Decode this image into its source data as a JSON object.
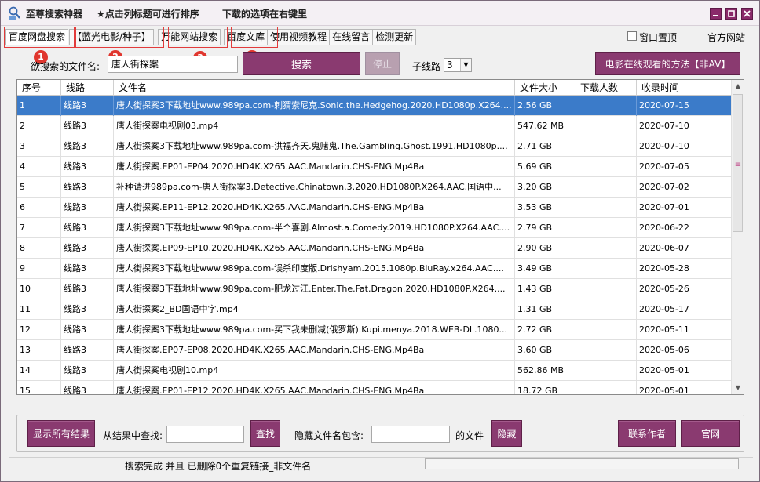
{
  "title_bar": {
    "app_name": "至尊搜索神器",
    "hint_sort": "★点击列标题可进行排序",
    "hint_download": "下载的选项在右键里"
  },
  "tabs": [
    {
      "label": "百度网盘搜索"
    },
    {
      "label": "【蓝光电影/种子】"
    },
    {
      "label": "万能网站搜索"
    },
    {
      "label": "百度文库"
    },
    {
      "label": "使用视频教程"
    },
    {
      "label": "在线留言"
    },
    {
      "label": "检测更新"
    }
  ],
  "badges": [
    "1",
    "2",
    "3",
    "4"
  ],
  "top_right": {
    "pin_label": "窗口置顶",
    "official_site": "官方网站"
  },
  "search": {
    "label": "欲搜索的文件名:",
    "value": "唐人街探案",
    "search_button": "搜索",
    "stop_button": "停止",
    "thread_label": "子线路",
    "thread_value": "3",
    "movie_button": "电影在线观看的方法【非AV】"
  },
  "table": {
    "columns": [
      "序号",
      "线路",
      "文件名",
      "文件大小",
      "下载人数",
      "收录时间"
    ],
    "rows": [
      [
        "1",
        "线路3",
        "唐人街探案3下载地址www.989pa.com-刺猬索尼克.Sonic.the.Hedgehog.2020.HD1080p.X264....",
        "2.56 GB",
        "",
        "2020-07-15"
      ],
      [
        "2",
        "线路3",
        "唐人街探案电视剧03.mp4",
        "547.62 MB",
        "",
        "2020-07-10"
      ],
      [
        "3",
        "线路3",
        "唐人街探案3下载地址www.989pa.com-洪福齐天.鬼赌鬼.The.Gambling.Ghost.1991.HD1080p....",
        "2.71 GB",
        "",
        "2020-07-10"
      ],
      [
        "4",
        "线路3",
        "唐人街探案.EP01-EP04.2020.HD4K.X265.AAC.Mandarin.CHS-ENG.Mp4Ba",
        "5.69 GB",
        "",
        "2020-07-05"
      ],
      [
        "5",
        "线路3",
        "补种请进989pa.com-唐人街探案3.Detective.Chinatown.3.2020.HD1080P.X264.AAC.国语中...",
        "3.20 GB",
        "",
        "2020-07-02"
      ],
      [
        "6",
        "线路3",
        "唐人街探案.EP11-EP12.2020.HD4K.X265.AAC.Mandarin.CHS-ENG.Mp4Ba",
        "3.53 GB",
        "",
        "2020-07-01"
      ],
      [
        "7",
        "线路3",
        "唐人街探案3下载地址www.989pa.com-半个喜剧.Almost.a.Comedy.2019.HD1080P.X264.AAC....",
        "2.79 GB",
        "",
        "2020-06-22"
      ],
      [
        "8",
        "线路3",
        "唐人街探案.EP09-EP10.2020.HD4K.X265.AAC.Mandarin.CHS-ENG.Mp4Ba",
        "2.90 GB",
        "",
        "2020-06-07"
      ],
      [
        "9",
        "线路3",
        "唐人街探案3下载地址www.989pa.com-误杀印度版.Drishyam.2015.1080p.BluRay.x264.AAC....",
        "3.49 GB",
        "",
        "2020-05-28"
      ],
      [
        "10",
        "线路3",
        "唐人街探案3下载地址www.989pa.com-肥龙过江.Enter.The.Fat.Dragon.2020.HD1080P.X264....",
        "1.43 GB",
        "",
        "2020-05-26"
      ],
      [
        "11",
        "线路3",
        "唐人街探案2_BD国语中字.mp4",
        "1.31 GB",
        "",
        "2020-05-17"
      ],
      [
        "12",
        "线路3",
        "唐人街探案3下载地址www.989pa.com-买下我未删减(俄罗斯).Kupi.menya.2018.WEB-DL.1080...",
        "2.72 GB",
        "",
        "2020-05-11"
      ],
      [
        "13",
        "线路3",
        "唐人街探案.EP07-EP08.2020.HD4K.X265.AAC.Mandarin.CHS-ENG.Mp4Ba",
        "3.60 GB",
        "",
        "2020-05-06"
      ],
      [
        "14",
        "线路3",
        "唐人街探案电视剧10.mp4",
        "562.86 MB",
        "",
        "2020-05-01"
      ],
      [
        "15",
        "线路3",
        "唐人街探案.EP01-EP12.2020.HD4K.X265.AAC.Mandarin.CHS-ENG.Mp4Ba",
        "18.72 GB",
        "",
        "2020-05-01"
      ]
    ]
  },
  "bottom": {
    "show_all": "显示所有结果",
    "find_label": "从结果中查找:",
    "find_value": "",
    "find_button": "查找",
    "hide_label": "隐藏文件名包含:",
    "hide_value": "",
    "hide_suffix": "的文件",
    "hide_button": "隐藏",
    "contact_button": "联系作者",
    "site_button": "官网"
  },
  "status": {
    "message": "搜索完成 并且 已删除0个重复链接_非文件名"
  },
  "colors": {
    "accent": "#8a3a70",
    "selection": "#3b7bc9",
    "highlight_box": "#e23b3b"
  }
}
